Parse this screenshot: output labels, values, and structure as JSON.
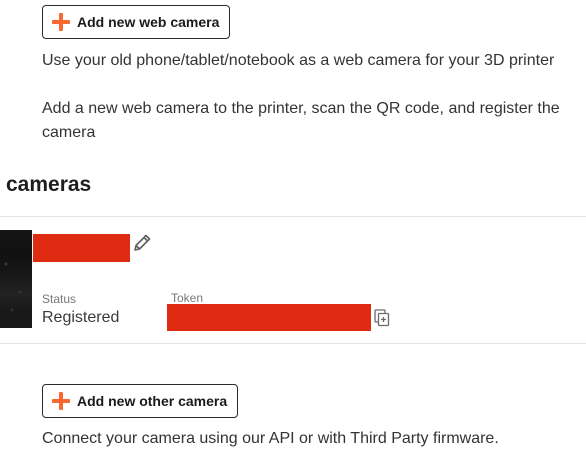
{
  "web_camera": {
    "add_button_label": "Add new web camera",
    "description_line1": "Use your old phone/tablet/notebook as a web camera for your 3D printer",
    "description_line2": "Add a new web camera to the printer, scan the QR code, and register the camera"
  },
  "cameras_section": {
    "title": "cameras",
    "items": [
      {
        "status_label": "Status",
        "status_value": "Registered",
        "token_label": "Token"
      }
    ]
  },
  "other_camera": {
    "add_button_label": "Add new other camera",
    "description": "Connect your camera using our API or with Third Party firmware."
  },
  "colors": {
    "accent": "#fa6831",
    "redaction": "#e02b13"
  },
  "icons": [
    "plus-icon",
    "pencil-icon",
    "copy-icon"
  ]
}
